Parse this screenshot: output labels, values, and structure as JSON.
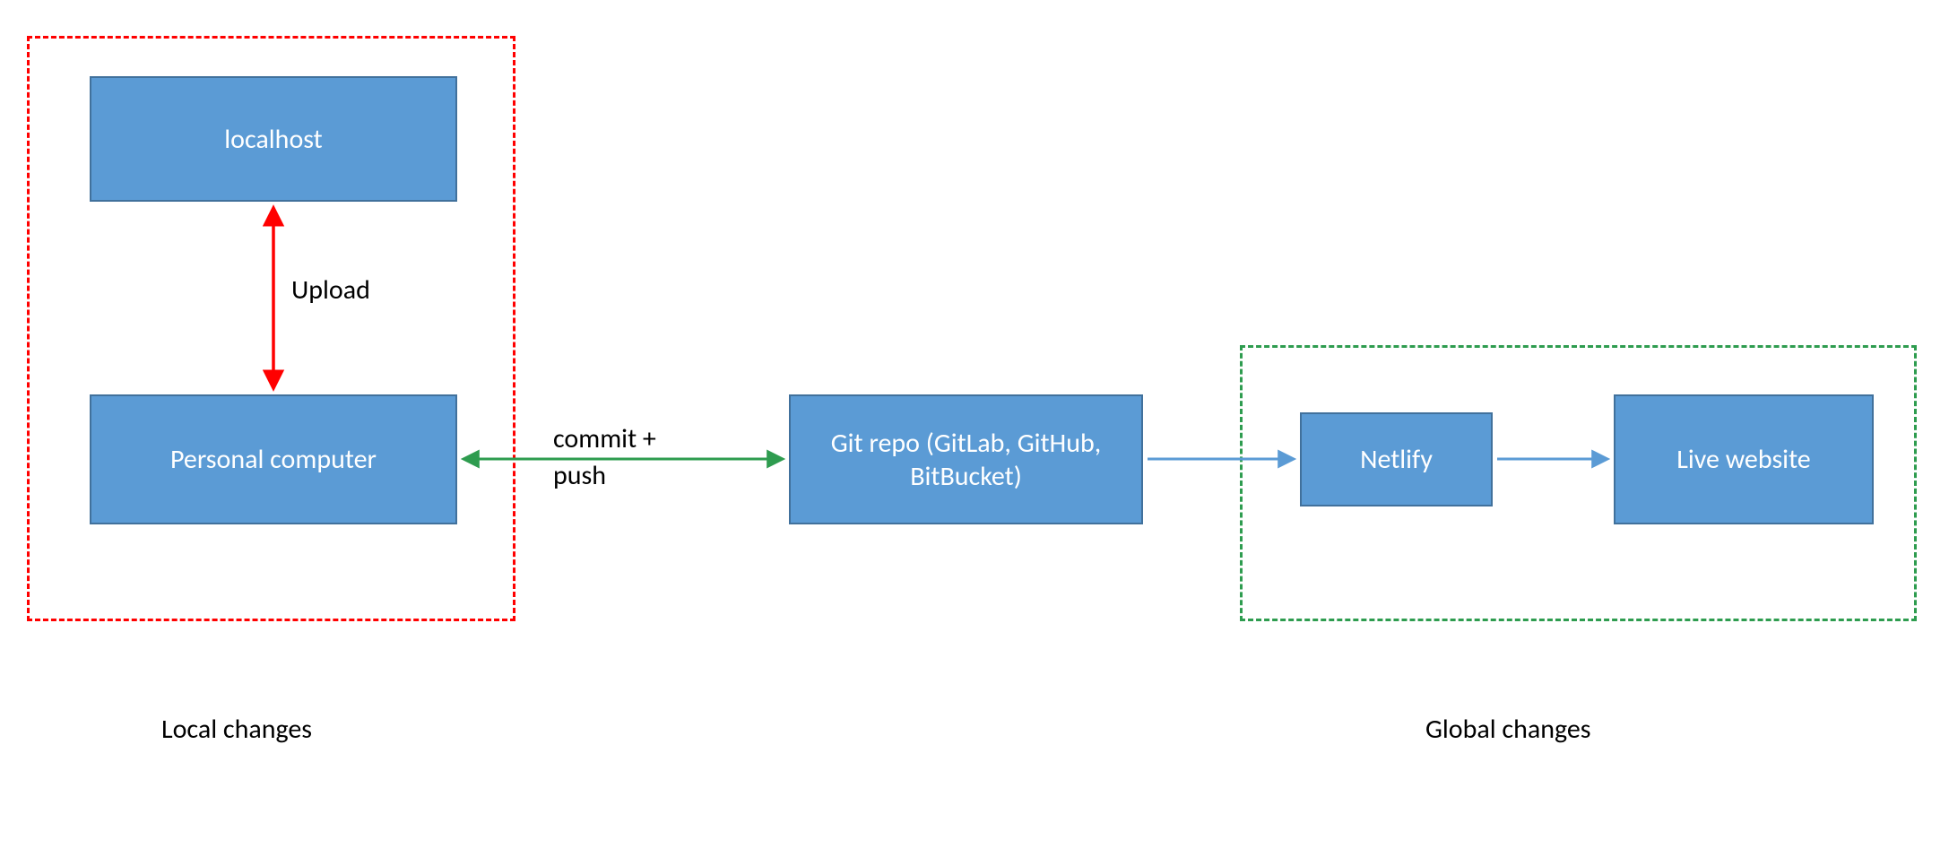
{
  "nodes": {
    "localhost": "localhost",
    "personal_computer": "Personal computer",
    "git_repo": "Git repo (GitLab, GitHub, BitBucket)",
    "netlify": "Netlify",
    "live_website": "Live website"
  },
  "labels": {
    "upload": "Upload",
    "commit_push": "commit + push",
    "local_changes": "Local changes",
    "global_changes": "Global changes"
  },
  "groups": {
    "local": {
      "color": "#ff0000"
    },
    "global": {
      "color": "#2e9c4f"
    }
  },
  "arrows": {
    "upload": {
      "color": "#ff0000",
      "double": true
    },
    "commit": {
      "color": "#2e9c4f",
      "double": true
    },
    "to_netlify": {
      "color": "#5b9bd5",
      "double": false
    },
    "to_live": {
      "color": "#5b9bd5",
      "double": false
    }
  }
}
